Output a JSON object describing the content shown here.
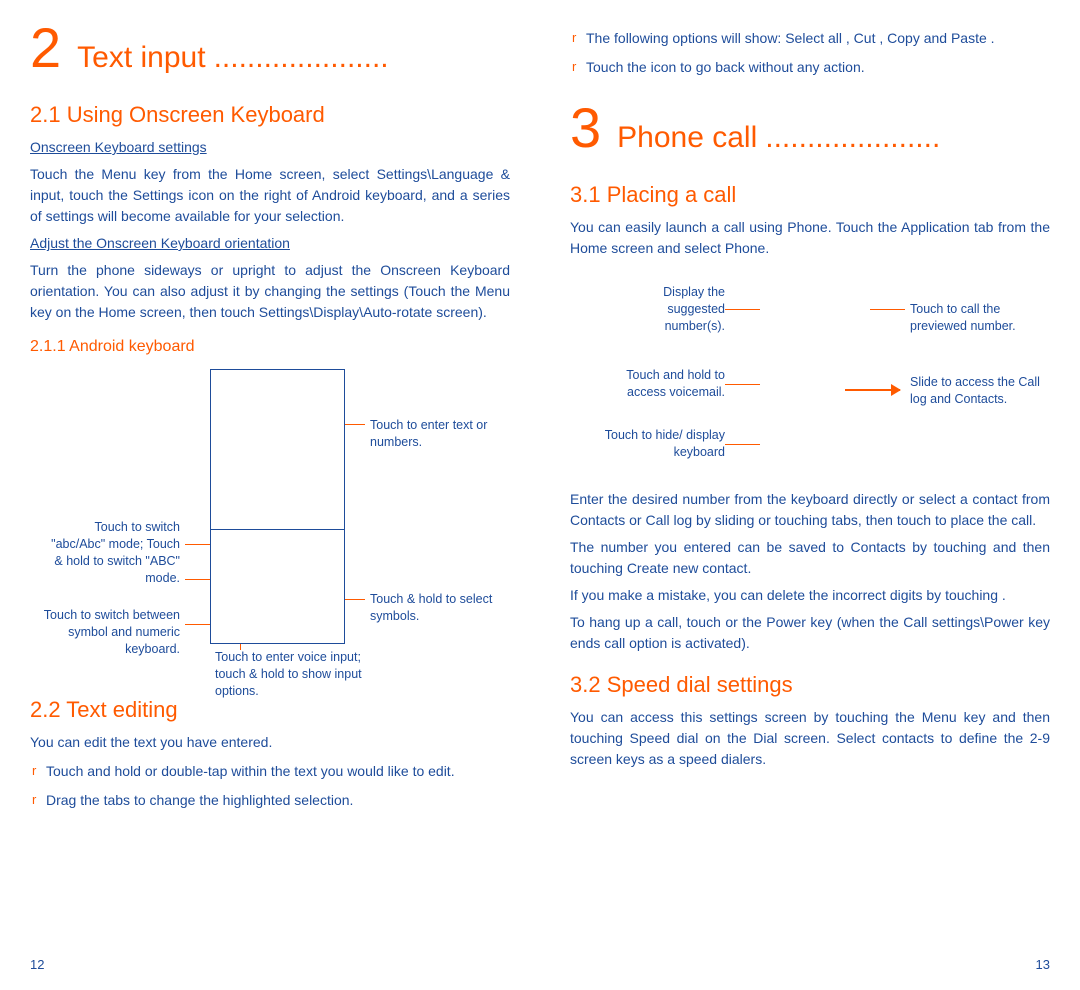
{
  "left": {
    "chapter_num": "2",
    "chapter_title": "Text input",
    "s1_title": "2.1   Using Onscreen Keyboard",
    "s1_sub1": "Onscreen Keyboard settings",
    "s1_p1": "Touch the Menu key from the Home screen, select Settings\\Language & input, touch the Settings icon     on the right of Android keyboard, and a series of settings will become available for your selection.",
    "s1_sub2": "Adjust the Onscreen Keyboard orientation",
    "s1_p2": "Turn the phone sideways or upright to adjust the Onscreen Keyboard orientation. You can also adjust it by changing the settings (Touch the Menu key on the Home screen, then touch Settings\\Display\\Auto-rotate screen).",
    "s1_1_title": "2.1.1  Android keyboard",
    "kbd_lbl_enter": "Touch to enter text or numbers.",
    "kbd_lbl_abc": "Touch to switch \"abc/Abc\" mode; Touch & hold to switch \"ABC\" mode.",
    "kbd_lbl_sym": "Touch to switch between symbol and numeric keyboard.",
    "kbd_lbl_voice": "Touch to enter voice input; touch & hold to show input options.",
    "kbd_lbl_hold": "Touch & hold to select symbols.",
    "s2_title": "2.2   Text editing",
    "s2_p1": "You can edit the text you have entered.",
    "s2_b1": "Touch and hold or double-tap within the text you would like to edit.",
    "s2_b2": "Drag the tabs to change the highlighted selection.",
    "page_num": "12"
  },
  "right": {
    "b3": "The following options will show: Select all      , Cut      , Copy     and Paste     .",
    "b4": "Touch the       icon to go back without any action.",
    "chapter_num": "3",
    "chapter_title": "Phone call",
    "s1_title": "3.1   Placing a call",
    "s1_p1": "You can easily launch a call using Phone. Touch the Application tab from the Home screen and select Phone.",
    "ph_lbl_display": "Display the suggested number(s).",
    "ph_lbl_call": "Touch to call the previewed number.",
    "ph_lbl_vm": "Touch and hold to access voicemail.",
    "ph_lbl_slide": "Slide to access the Call log and Contacts.",
    "ph_lbl_hide": "Touch to hide/ display keyboard",
    "s1_p2": "Enter the desired number from the keyboard directly or select a contact from Contacts or Call log by sliding or touching tabs, then touch           to place the call.",
    "s1_p3": "The number you entered can be saved to Contacts by touching     and then touching Create new contact.",
    "s1_p4": "If you make a mistake, you can delete the incorrect digits by touching     .",
    "s1_p5": "To hang up a call, touch           or the Power key (when the Call settings\\Power key ends call option is activated).",
    "s2_title": "3.2   Speed dial settings",
    "s2_p1": "You can access this settings screen by touching the Menu key and then touching Speed dial on the Dial screen. Select contacts to define the 2-9 screen keys as a speed dialers.",
    "page_num": "13"
  },
  "dots": "....................."
}
